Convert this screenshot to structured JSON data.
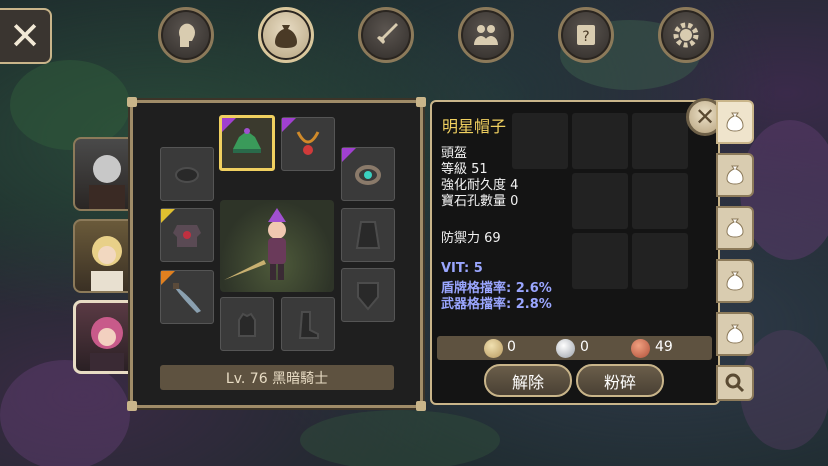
{
  "tabs": [
    {
      "name": "character",
      "icon": "head-icon"
    },
    {
      "name": "bag",
      "icon": "bag-icon"
    },
    {
      "name": "skills",
      "icon": "sword-icon"
    },
    {
      "name": "social",
      "icon": "people-icon"
    },
    {
      "name": "quest",
      "icon": "scroll-icon"
    },
    {
      "name": "settings",
      "icon": "gear-icon"
    }
  ],
  "equipment": {
    "level_label": "Lv. 76 黑暗騎士"
  },
  "item": {
    "name": "明星帽子",
    "type": "頭盔",
    "level": "等級 51",
    "durability": "強化耐久度 4",
    "gem_slots": "寶石孔數量 0",
    "defense": "防禦力 69",
    "stat_vit": "VIT: 5",
    "stat_shield_block": "盾牌格擋率: 2.6%",
    "stat_weapon_block": "武器格擋率: 2.8%"
  },
  "currency": {
    "gold": "0",
    "silver": "0",
    "copper": "49"
  },
  "actions": {
    "unequip": "解除",
    "shatter": "粉碎"
  },
  "colors": {
    "title": "#f0d060",
    "stat_blue": "#9aa6ff",
    "gold_border": "#c9b58a"
  }
}
